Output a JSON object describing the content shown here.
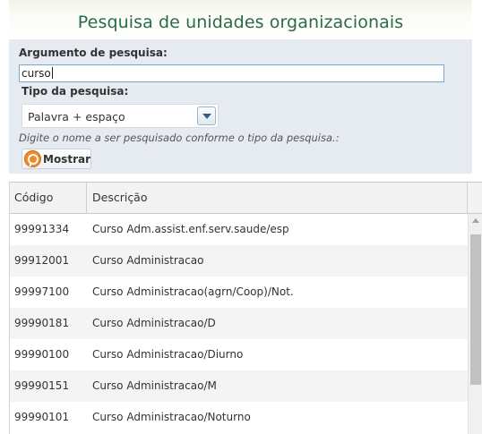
{
  "header": {
    "title": "Pesquisa de unidades organizacionais"
  },
  "search": {
    "argument_label": "Argumento de pesquisa:",
    "argument_value": "curso",
    "type_label": "Tipo da pesquisa:",
    "type_selected": "Palavra + espaço",
    "hint": "Digite o nome a ser pesquisado conforme o tipo da pesquisa.:",
    "show_button": "Mostrar",
    "show_button_icon": "magnifier-icon"
  },
  "colors": {
    "title": "#2c6a46",
    "panel_bg": "#e6ebf1",
    "button_icon": "#f08a2c",
    "dropdown_arrow": "#2d5f96"
  },
  "table": {
    "columns": [
      "Código",
      "Descrição"
    ],
    "rows": [
      {
        "code": "99991334",
        "desc": "Curso Adm.assist.enf.serv.saude/esp"
      },
      {
        "code": "99912001",
        "desc": "Curso Administracao"
      },
      {
        "code": "99997100",
        "desc": "Curso Administracao(agrn/Coop)/Not."
      },
      {
        "code": "99990181",
        "desc": "Curso Administracao/D"
      },
      {
        "code": "99990100",
        "desc": "Curso Administracao/Diurno"
      },
      {
        "code": "99990151",
        "desc": "Curso Administracao/M"
      },
      {
        "code": "99990101",
        "desc": "Curso Administracao/Noturno"
      }
    ]
  }
}
